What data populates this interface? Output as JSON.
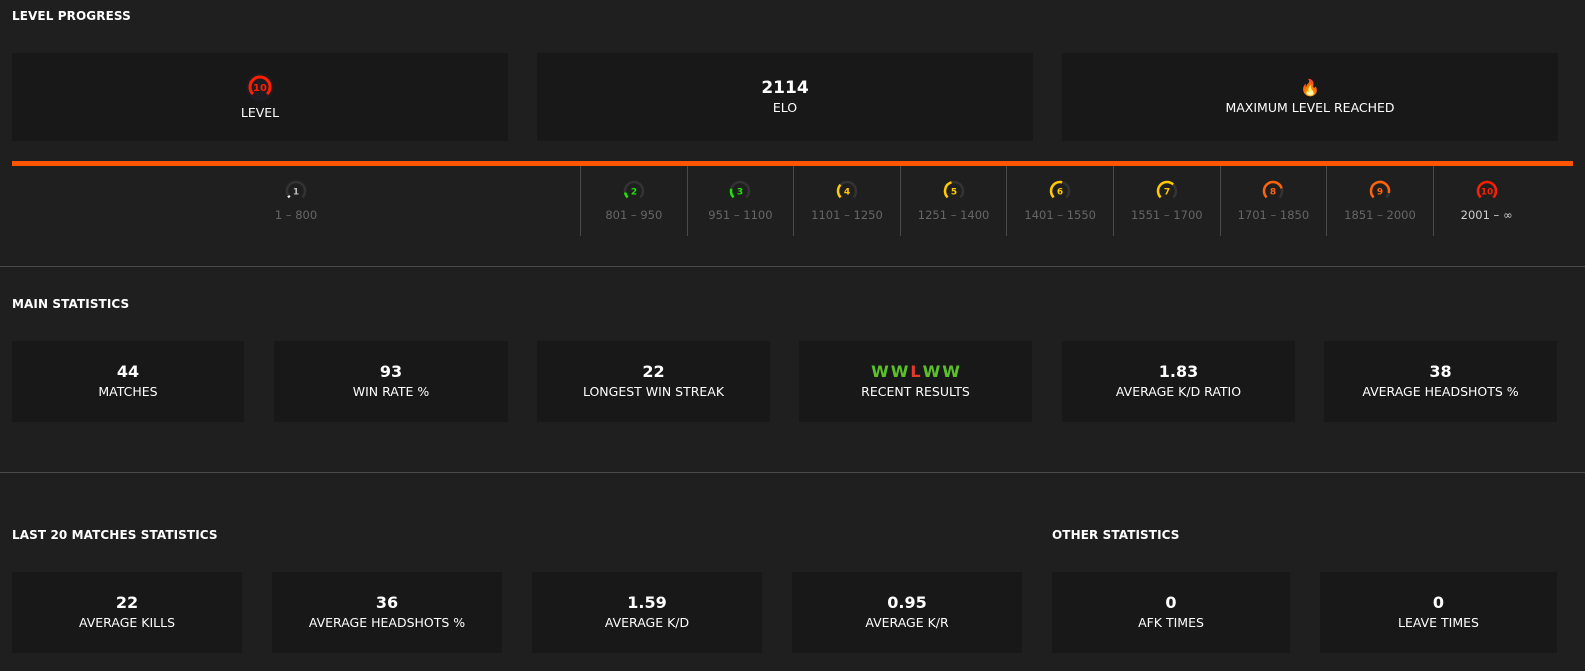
{
  "level_progress": {
    "title": "LEVEL PROGRESS",
    "level_card": {
      "level": "10",
      "label": "LEVEL",
      "color": "#fe1f00",
      "fill": 1.0
    },
    "elo_card": {
      "value": "2114",
      "label": "ELO"
    },
    "max_card": {
      "icon": "🔥",
      "label": "MAXIMUM LEVEL REACHED"
    },
    "progress_fill": 1.0,
    "accent_color": "#ff5500",
    "levels": [
      {
        "level": "1",
        "range": "1 – 800",
        "color": "#eeeeee",
        "fill": 0.05
      },
      {
        "level": "2",
        "range": "801 – 950",
        "color": "#1ce400",
        "fill": 0.13
      },
      {
        "level": "3",
        "range": "951 – 1100",
        "color": "#1ce400",
        "fill": 0.22
      },
      {
        "level": "4",
        "range": "1101 – 1250",
        "color": "#ffc800",
        "fill": 0.33
      },
      {
        "level": "5",
        "range": "1251 – 1400",
        "color": "#ffc800",
        "fill": 0.44
      },
      {
        "level": "6",
        "range": "1401 – 1550",
        "color": "#ffc800",
        "fill": 0.55
      },
      {
        "level": "7",
        "range": "1551 – 1700",
        "color": "#ffc800",
        "fill": 0.66
      },
      {
        "level": "8",
        "range": "1701 – 1850",
        "color": "#ff6309",
        "fill": 0.77
      },
      {
        "level": "9",
        "range": "1851 – 2000",
        "color": "#ff6309",
        "fill": 0.88
      },
      {
        "level": "10",
        "range": "2001 – ∞",
        "color": "#fe1f00",
        "fill": 1.0,
        "current": true
      }
    ]
  },
  "main_statistics": {
    "title": "MAIN STATISTICS",
    "cards": [
      {
        "value": "44",
        "label": "MATCHES"
      },
      {
        "value": "93",
        "label": "WIN RATE %"
      },
      {
        "value": "22",
        "label": "LONGEST WIN STREAK"
      },
      {
        "value": "",
        "label": "RECENT RESULTS"
      },
      {
        "value": "1.83",
        "label": "AVERAGE K/D RATIO"
      },
      {
        "value": "38",
        "label": "AVERAGE HEADSHOTS %"
      }
    ],
    "recent_results": [
      "W",
      "W",
      "L",
      "W",
      "W"
    ],
    "win_color": "#5bc12b",
    "loss_color": "#e53a2a"
  },
  "last20": {
    "title": "LAST 20 MATCHES STATISTICS",
    "cards": [
      {
        "value": "22",
        "label": "AVERAGE KILLS"
      },
      {
        "value": "36",
        "label": "AVERAGE HEADSHOTS %"
      },
      {
        "value": "1.59",
        "label": "AVERAGE K/D"
      },
      {
        "value": "0.95",
        "label": "AVERAGE K/R"
      }
    ]
  },
  "other": {
    "title": "OTHER STATISTICS",
    "cards": [
      {
        "value": "0",
        "label": "AFK TIMES"
      },
      {
        "value": "0",
        "label": "LEAVE TIMES"
      }
    ]
  }
}
